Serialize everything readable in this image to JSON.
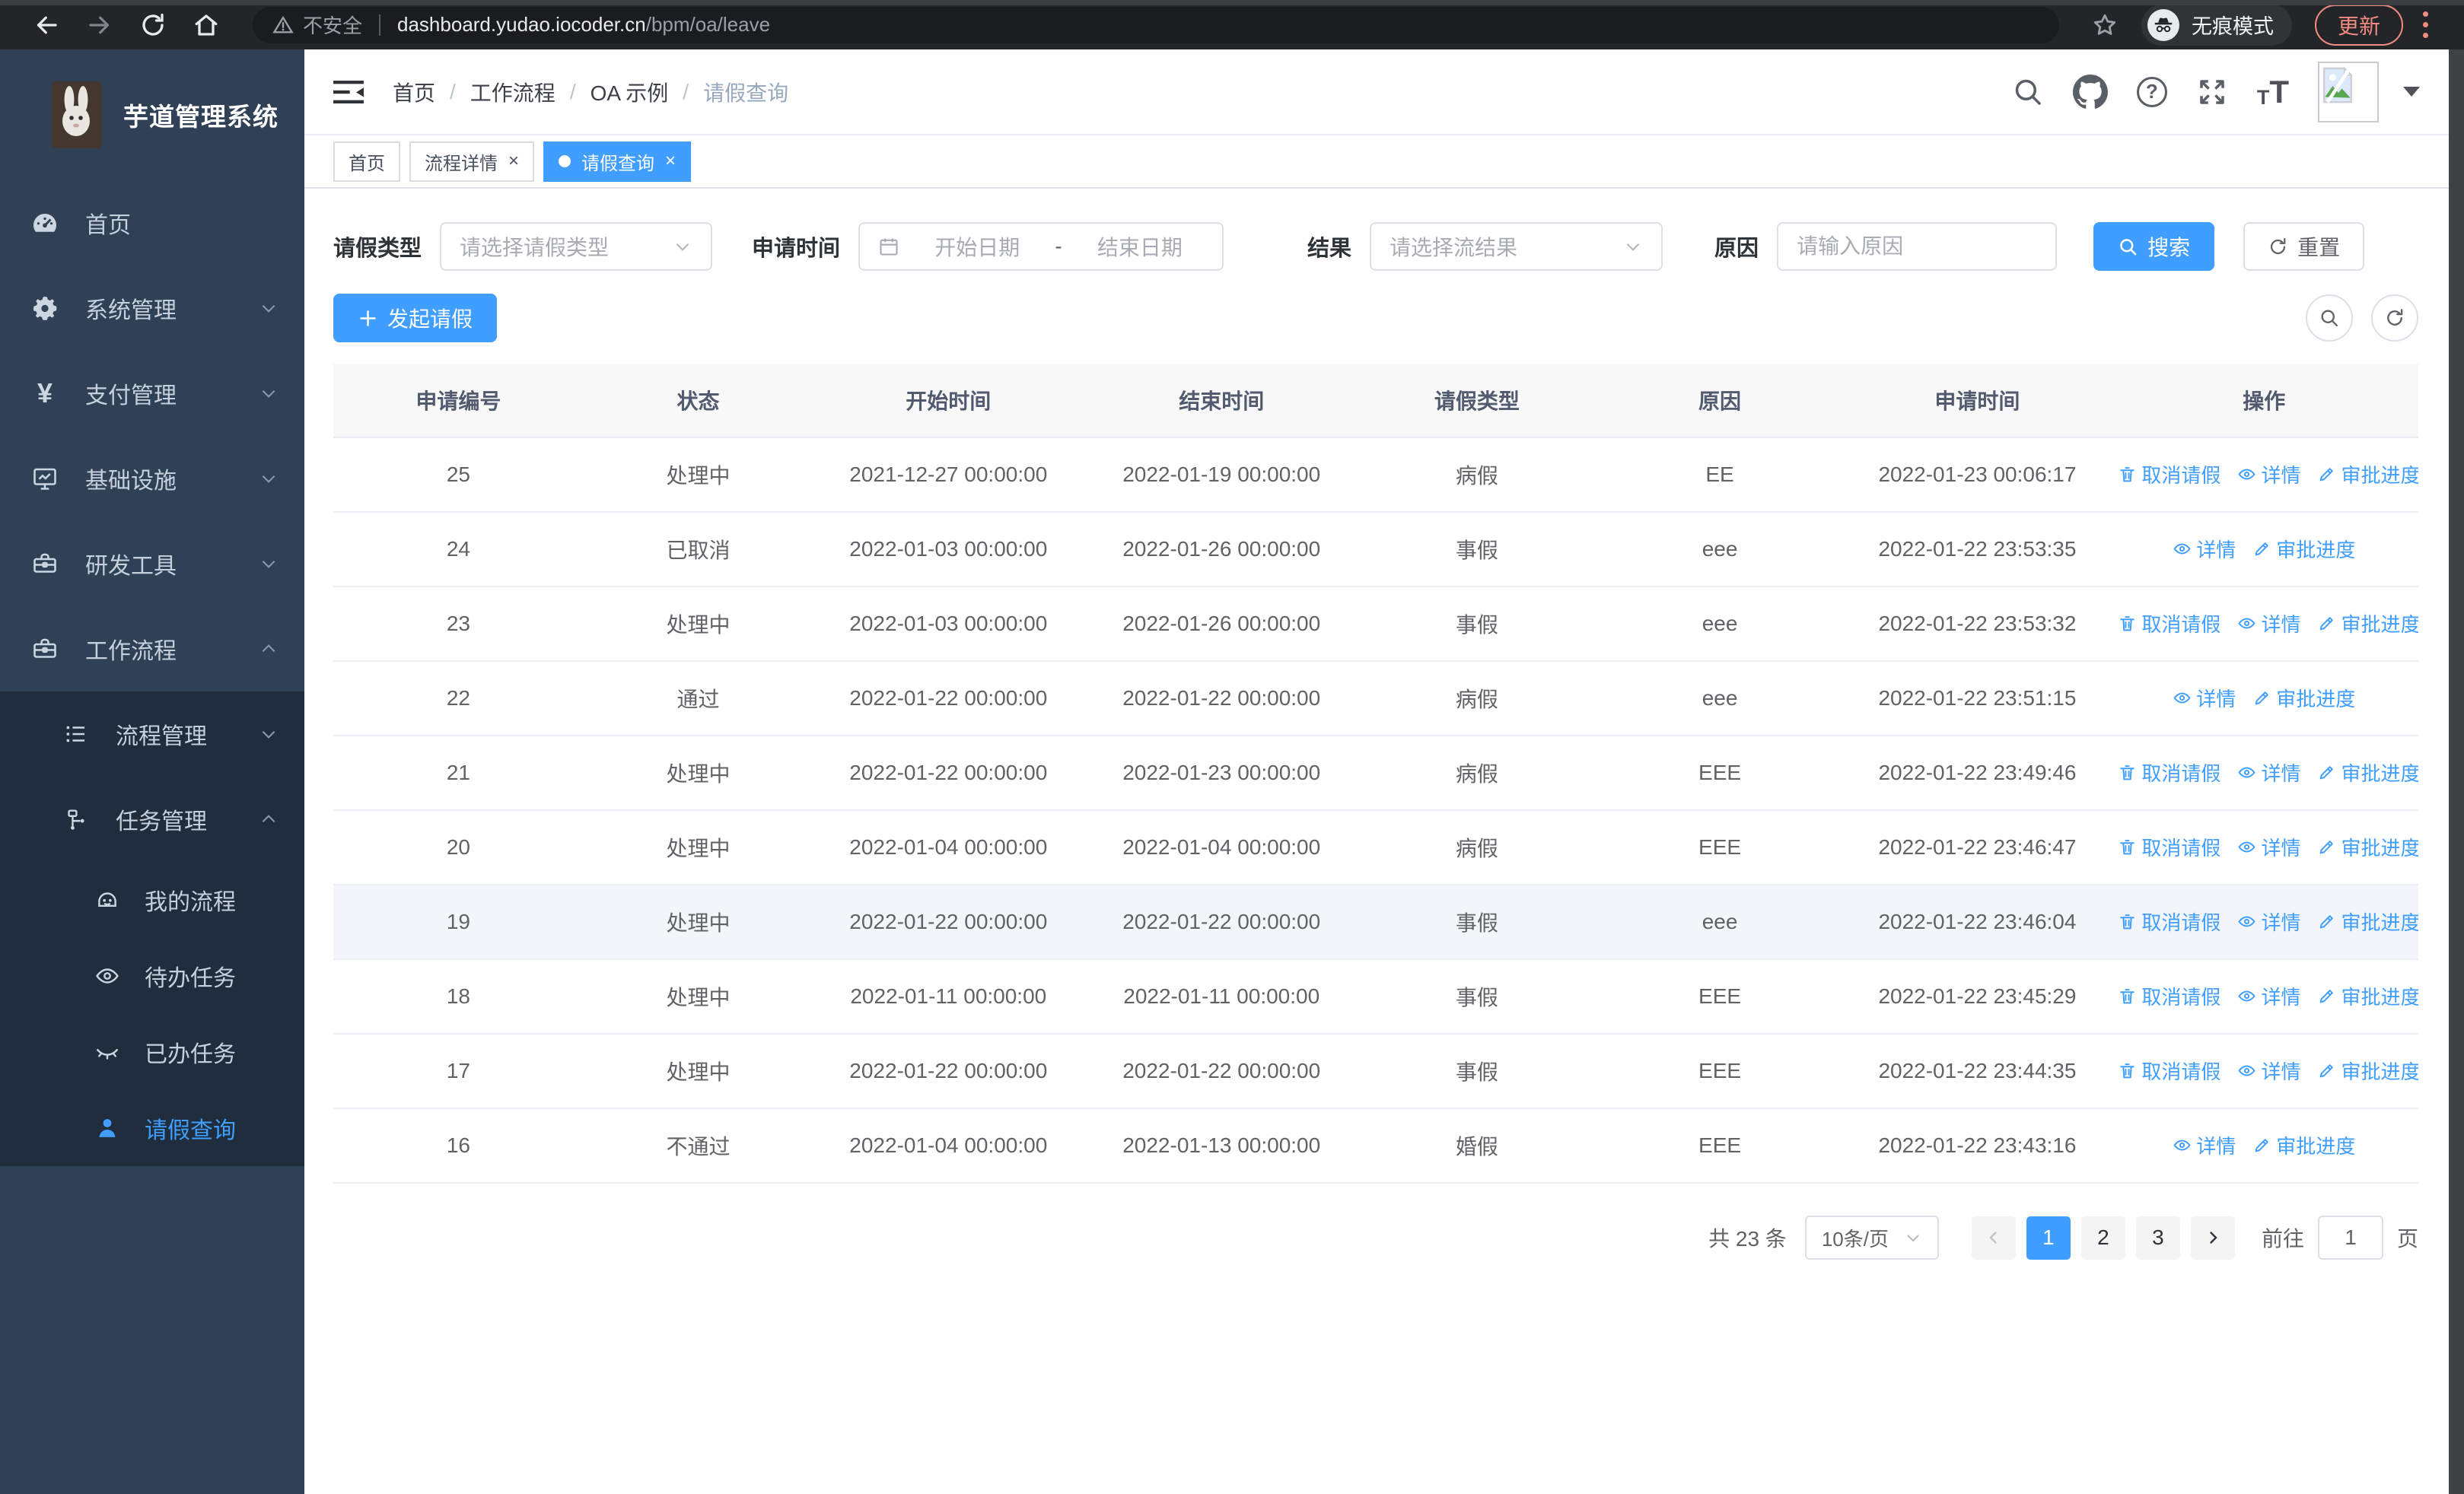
{
  "browser": {
    "security_label": "不安全",
    "url_host": "dashboard.yudao.iocoder.cn",
    "url_path": "/bpm/oa/leave",
    "incognito_label": "无痕模式",
    "update_label": "更新"
  },
  "sidebar": {
    "app_title": "芋道管理系统",
    "items": [
      {
        "label": "首页",
        "icon": "dashboard-icon"
      },
      {
        "label": "系统管理",
        "icon": "gear-icon"
      },
      {
        "label": "支付管理",
        "icon": "yen-icon"
      },
      {
        "label": "基础设施",
        "icon": "monitor-icon"
      },
      {
        "label": "研发工具",
        "icon": "toolbox-icon"
      },
      {
        "label": "工作流程",
        "icon": "briefcase-icon"
      }
    ],
    "workflow_children": [
      {
        "label": "流程管理",
        "icon": "tree-list-icon"
      },
      {
        "label": "任务管理",
        "icon": "flow-icon"
      }
    ],
    "task_children": [
      {
        "label": "我的流程",
        "icon": "robot-icon"
      },
      {
        "label": "待办任务",
        "icon": "eye-icon"
      },
      {
        "label": "已办任务",
        "icon": "eye-closed-icon"
      },
      {
        "label": "请假查询",
        "icon": "user-icon"
      }
    ],
    "active_item": "请假查询"
  },
  "navbar": {
    "breadcrumb": [
      {
        "label": "首页"
      },
      {
        "label": "工作流程"
      },
      {
        "label": "OA 示例"
      },
      {
        "label": "请假查询"
      }
    ]
  },
  "tabs": [
    {
      "label": "首页",
      "closable": false,
      "active": false
    },
    {
      "label": "流程详情",
      "closable": true,
      "active": false
    },
    {
      "label": "请假查询",
      "closable": true,
      "active": true
    }
  ],
  "filters": {
    "leave_type_label": "请假类型",
    "leave_type_placeholder": "请选择请假类型",
    "apply_time_label": "申请时间",
    "date_start_placeholder": "开始日期",
    "date_separator": "-",
    "date_end_placeholder": "结束日期",
    "result_label": "结果",
    "result_placeholder": "请选择流结果",
    "reason_label": "原因",
    "reason_placeholder": "请输入原因",
    "search_button": "搜索",
    "reset_button": "重置"
  },
  "toolbar": {
    "create_label": "发起请假"
  },
  "table": {
    "headers": [
      "申请编号",
      "状态",
      "开始时间",
      "结束时间",
      "请假类型",
      "原因",
      "申请时间",
      "操作"
    ],
    "action_labels": {
      "cancel": "取消请假",
      "detail": "详情",
      "progress": "审批进度"
    },
    "rows": [
      {
        "id": "25",
        "status": "处理中",
        "start": "2021-12-27 00:00:00",
        "end": "2022-01-19 00:00:00",
        "type": "病假",
        "reason": "EE",
        "applied": "2022-01-23 00:06:17",
        "actions": [
          "cancel",
          "detail",
          "progress"
        ],
        "highlight": false
      },
      {
        "id": "24",
        "status": "已取消",
        "start": "2022-01-03 00:00:00",
        "end": "2022-01-26 00:00:00",
        "type": "事假",
        "reason": "eee",
        "applied": "2022-01-22 23:53:35",
        "actions": [
          "detail",
          "progress"
        ],
        "highlight": false
      },
      {
        "id": "23",
        "status": "处理中",
        "start": "2022-01-03 00:00:00",
        "end": "2022-01-26 00:00:00",
        "type": "事假",
        "reason": "eee",
        "applied": "2022-01-22 23:53:32",
        "actions": [
          "cancel",
          "detail",
          "progress"
        ],
        "highlight": false
      },
      {
        "id": "22",
        "status": "通过",
        "start": "2022-01-22 00:00:00",
        "end": "2022-01-22 00:00:00",
        "type": "病假",
        "reason": "eee",
        "applied": "2022-01-22 23:51:15",
        "actions": [
          "detail",
          "progress"
        ],
        "highlight": false
      },
      {
        "id": "21",
        "status": "处理中",
        "start": "2022-01-22 00:00:00",
        "end": "2022-01-23 00:00:00",
        "type": "病假",
        "reason": "EEE",
        "applied": "2022-01-22 23:49:46",
        "actions": [
          "cancel",
          "detail",
          "progress"
        ],
        "highlight": false
      },
      {
        "id": "20",
        "status": "处理中",
        "start": "2022-01-04 00:00:00",
        "end": "2022-01-04 00:00:00",
        "type": "病假",
        "reason": "EEE",
        "applied": "2022-01-22 23:46:47",
        "actions": [
          "cancel",
          "detail",
          "progress"
        ],
        "highlight": false
      },
      {
        "id": "19",
        "status": "处理中",
        "start": "2022-01-22 00:00:00",
        "end": "2022-01-22 00:00:00",
        "type": "事假",
        "reason": "eee",
        "applied": "2022-01-22 23:46:04",
        "actions": [
          "cancel",
          "detail",
          "progress"
        ],
        "highlight": true
      },
      {
        "id": "18",
        "status": "处理中",
        "start": "2022-01-11 00:00:00",
        "end": "2022-01-11 00:00:00",
        "type": "事假",
        "reason": "EEE",
        "applied": "2022-01-22 23:45:29",
        "actions": [
          "cancel",
          "detail",
          "progress"
        ],
        "highlight": false
      },
      {
        "id": "17",
        "status": "处理中",
        "start": "2022-01-22 00:00:00",
        "end": "2022-01-22 00:00:00",
        "type": "事假",
        "reason": "EEE",
        "applied": "2022-01-22 23:44:35",
        "actions": [
          "cancel",
          "detail",
          "progress"
        ],
        "highlight": false
      },
      {
        "id": "16",
        "status": "不通过",
        "start": "2022-01-04 00:00:00",
        "end": "2022-01-13 00:00:00",
        "type": "婚假",
        "reason": "EEE",
        "applied": "2022-01-22 23:43:16",
        "actions": [
          "detail",
          "progress"
        ],
        "highlight": false
      }
    ]
  },
  "pagination": {
    "total_label": "共 23 条",
    "page_size_label": "10条/页",
    "pages": [
      "1",
      "2",
      "3"
    ],
    "active_page": "1",
    "goto_prefix": "前往",
    "goto_value": "1",
    "goto_suffix": "页"
  },
  "colors": {
    "accent": "#409eff",
    "sidebar_bg": "#304156",
    "submenu_bg": "#1f2d3d",
    "table_header_bg": "#f8f8f9",
    "update_accent": "#f28b82"
  },
  "icons": {
    "search-icon": "magnifier",
    "github-icon": "octocat mark",
    "help-icon": "question circle",
    "fullscreen-icon": "expand arrows",
    "font-size-icon": "tT",
    "cancel-leave-icon": "trash",
    "detail-icon": "eye",
    "progress-icon": "pen"
  }
}
